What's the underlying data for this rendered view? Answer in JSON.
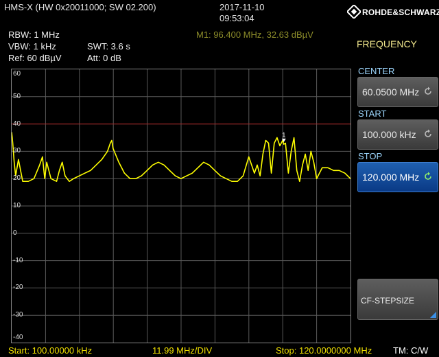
{
  "header": {
    "device": "HMS-X (HW 0x20011000; SW 02.200)",
    "date": "2017-11-10",
    "time": "09:53:04",
    "brand": "ROHDE&SCHWARZ"
  },
  "settings": {
    "rbw": "RBW: 1 MHz",
    "vbw": "VBW: 1 kHz",
    "swt": "SWT: 3.6 s",
    "ref": "Ref: 60 dBµV",
    "att": "Att: 0 dB",
    "marker": "M1: 96.400 MHz, 32.63 dBµV"
  },
  "menu": {
    "title": "FREQUENCY",
    "center_label": "CENTER",
    "center_value": "60.0500 MHz",
    "start_label": "START",
    "start_value": "100.000 kHz",
    "stop_label": "STOP",
    "stop_value": "120.000 MHz",
    "cf_stepsize": "CF-STEPSIZE"
  },
  "footer": {
    "start": "Start: 100.00000 kHz",
    "div": "11.99 MHz/DIV",
    "stop": "Stop: 120.0000000 MHz",
    "tm": "TM: C/W"
  },
  "colors": {
    "trace": "#ffff00",
    "ref_line": "#b22222",
    "grid": "#5a5a5a",
    "active_softkey": "#1f5fb0"
  },
  "chart_data": {
    "type": "line",
    "xlim": [
      0.1,
      120.0
    ],
    "ylim": [
      -40,
      60
    ],
    "ytick_labels": [
      "60",
      "50",
      "40",
      "30",
      "20",
      "10",
      "0",
      "-10",
      "-20",
      "-30",
      "-40"
    ],
    "ref_level": 40,
    "marker": {
      "label": "1",
      "x": 96.4,
      "y": 32.63
    },
    "series": [
      {
        "x": [
          0.1,
          0.5,
          1.0,
          1.5,
          2.5,
          4.0,
          6.0,
          8.0,
          10.0,
          11.0,
          11.8,
          12.5,
          14.0,
          16.0,
          17.0,
          18.0,
          19.0,
          20.5,
          22.0,
          24.0,
          26.0,
          28.0,
          30.0,
          32.0,
          34.0,
          35.0,
          35.5,
          36.0,
          38.0,
          40.0,
          42.0,
          44.0,
          46.0,
          48.0,
          50.0,
          52.0,
          54.0,
          56.0,
          58.0,
          60.0,
          62.0,
          64.0,
          66.0,
          68.0,
          70.0,
          72.0,
          74.0,
          76.0,
          78.0,
          80.0,
          82.0,
          84.0,
          86.0,
          87.0,
          88.0,
          89.0,
          90.0,
          91.0,
          92.0,
          93.0,
          94.0,
          95.0,
          96.0,
          96.4,
          97.0,
          98.0,
          99.0,
          100.0,
          101.0,
          102.0,
          103.0,
          104.0,
          105.0,
          106.0,
          107.0,
          108.0,
          109.0,
          110.0,
          112.0,
          114.0,
          116.0,
          118.0,
          120.0
        ],
        "y": [
          37,
          33,
          26,
          21,
          27,
          19,
          19,
          20,
          25,
          28,
          20,
          26,
          20,
          19,
          23,
          26,
          21,
          19,
          20,
          21,
          22,
          23,
          25,
          27,
          30,
          33,
          34,
          31,
          26,
          22,
          20,
          20,
          21,
          23,
          25,
          26,
          25,
          23,
          21,
          20,
          21,
          22,
          24,
          26,
          25,
          23,
          21,
          20,
          19,
          19,
          21,
          28,
          22,
          25,
          21,
          29,
          34,
          33,
          22,
          33,
          35,
          32,
          34,
          32.6,
          33,
          22,
          30,
          35,
          23,
          19,
          25,
          29,
          23,
          30,
          26,
          20,
          22,
          24,
          24,
          23,
          23,
          22,
          20
        ]
      }
    ]
  }
}
